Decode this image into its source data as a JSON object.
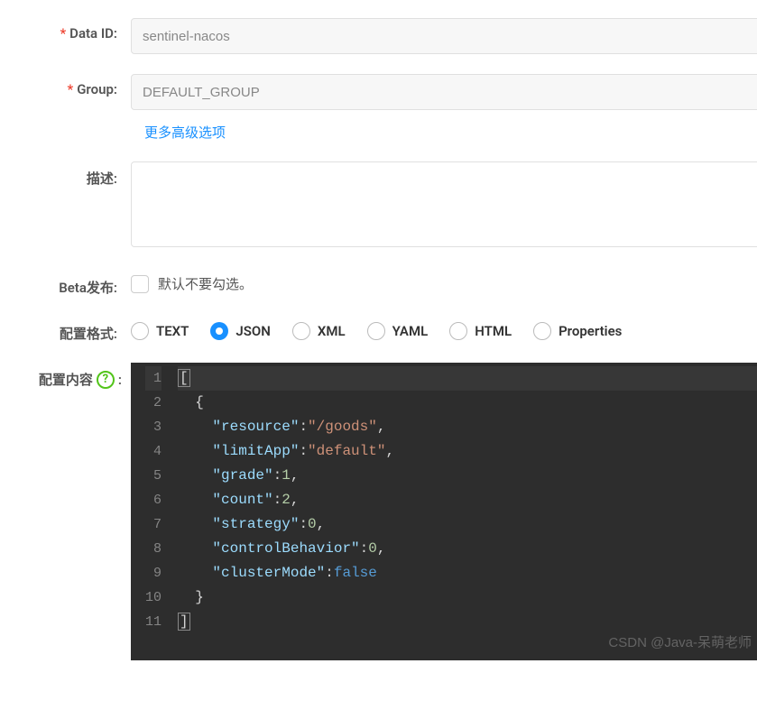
{
  "form": {
    "data_id": {
      "label": "Data ID:",
      "value": "sentinel-nacos"
    },
    "group": {
      "label": "Group:",
      "value": "DEFAULT_GROUP"
    },
    "advanced_link": "更多高级选项",
    "description": {
      "label": "描述:",
      "value": ""
    },
    "beta": {
      "label": "Beta发布:",
      "hint": "默认不要勾选。",
      "checked": false
    },
    "format": {
      "label": "配置格式:",
      "options": [
        "TEXT",
        "JSON",
        "XML",
        "YAML",
        "HTML",
        "Properties"
      ],
      "selected": "JSON"
    },
    "content": {
      "label": "配置内容",
      "colon": ":"
    }
  },
  "editor": {
    "line_count": 11,
    "tokens": [
      [
        {
          "t": "bracket-hl",
          "v": "["
        }
      ],
      [
        {
          "t": "punc",
          "v": "  {"
        }
      ],
      [
        {
          "t": "punc",
          "v": "    "
        },
        {
          "t": "key",
          "v": "\"resource\""
        },
        {
          "t": "punc",
          "v": ":"
        },
        {
          "t": "str",
          "v": "\"/goods\""
        },
        {
          "t": "punc",
          "v": ","
        }
      ],
      [
        {
          "t": "punc",
          "v": "    "
        },
        {
          "t": "key",
          "v": "\"limitApp\""
        },
        {
          "t": "punc",
          "v": ":"
        },
        {
          "t": "str",
          "v": "\"default\""
        },
        {
          "t": "punc",
          "v": ","
        }
      ],
      [
        {
          "t": "punc",
          "v": "    "
        },
        {
          "t": "key",
          "v": "\"grade\""
        },
        {
          "t": "punc",
          "v": ":"
        },
        {
          "t": "num",
          "v": "1"
        },
        {
          "t": "punc",
          "v": ","
        }
      ],
      [
        {
          "t": "punc",
          "v": "    "
        },
        {
          "t": "key",
          "v": "\"count\""
        },
        {
          "t": "punc",
          "v": ":"
        },
        {
          "t": "num",
          "v": "2"
        },
        {
          "t": "punc",
          "v": ","
        }
      ],
      [
        {
          "t": "punc",
          "v": "    "
        },
        {
          "t": "key",
          "v": "\"strategy\""
        },
        {
          "t": "punc",
          "v": ":"
        },
        {
          "t": "num",
          "v": "0"
        },
        {
          "t": "punc",
          "v": ","
        }
      ],
      [
        {
          "t": "punc",
          "v": "    "
        },
        {
          "t": "key",
          "v": "\"controlBehavior\""
        },
        {
          "t": "punc",
          "v": ":"
        },
        {
          "t": "num",
          "v": "0"
        },
        {
          "t": "punc",
          "v": ","
        }
      ],
      [
        {
          "t": "punc",
          "v": "    "
        },
        {
          "t": "key",
          "v": "\"clusterMode\""
        },
        {
          "t": "punc",
          "v": ":"
        },
        {
          "t": "bool",
          "v": "false"
        }
      ],
      [
        {
          "t": "punc",
          "v": "  }"
        }
      ],
      [
        {
          "t": "bracket-hl",
          "v": "]"
        }
      ]
    ],
    "raw_json": [
      {
        "resource": "/goods",
        "limitApp": "default",
        "grade": 1,
        "count": 2,
        "strategy": 0,
        "controlBehavior": 0,
        "clusterMode": false
      }
    ]
  },
  "watermark": "CSDN @Java-呆萌老师"
}
